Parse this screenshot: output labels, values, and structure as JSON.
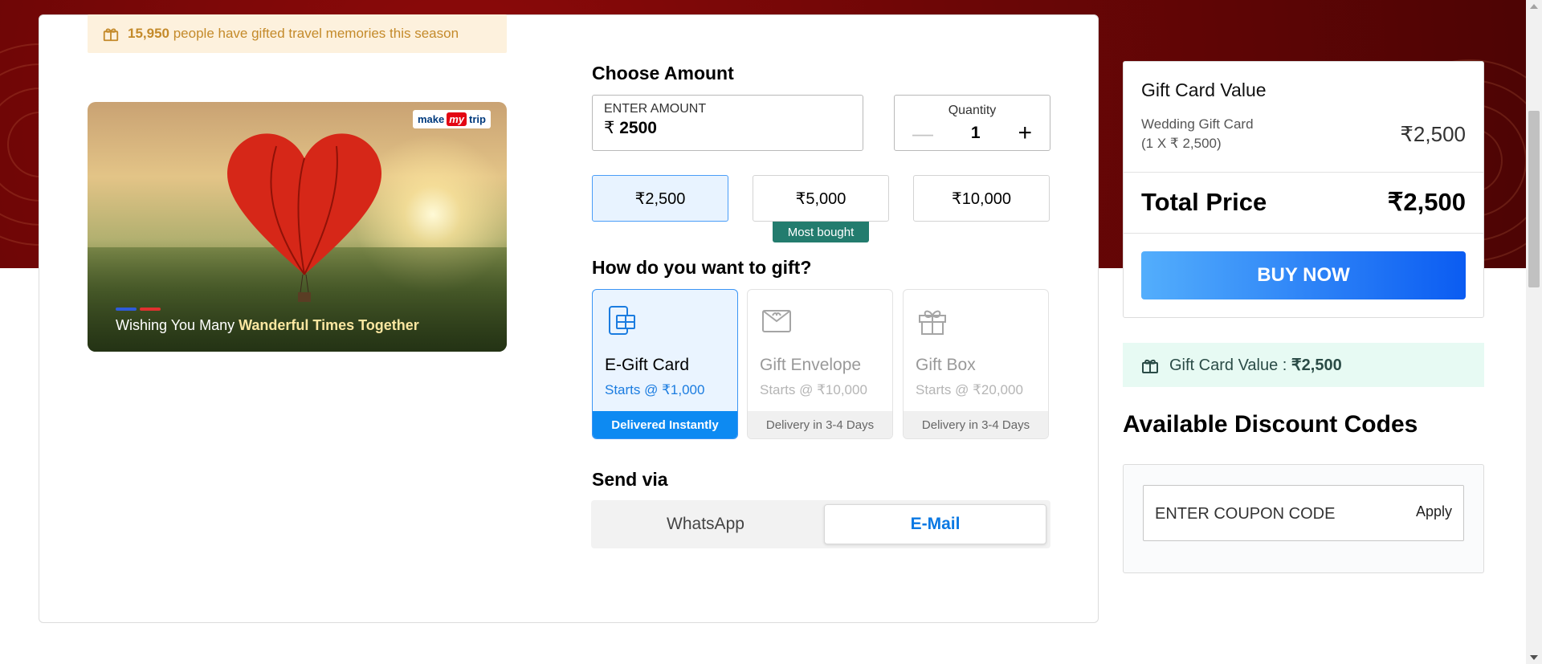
{
  "promo": {
    "count": "15,950",
    "text": " people have gifted travel memories this season",
    "icon": "gift-icon"
  },
  "card": {
    "brand_make": "make",
    "brand_my": "my",
    "brand_trip": "trip",
    "caption_prefix": "Wishing You Many ",
    "caption_bold": "Wanderful Times Together",
    "dot_colors": [
      "#2e5bd8",
      "#e0312f"
    ]
  },
  "choose_amount": {
    "title": "Choose Amount",
    "enter_label": "ENTER AMOUNT",
    "currency": "₹",
    "value": "2500",
    "quantity_label": "Quantity",
    "quantity_minus": "—",
    "quantity_value": "1",
    "quantity_plus": "+",
    "presets": [
      {
        "label": "₹2,500",
        "selected": true
      },
      {
        "label": "₹5,000",
        "selected": false
      },
      {
        "label": "₹10,000",
        "selected": false
      }
    ],
    "most_bought": "Most bought"
  },
  "gift_method": {
    "title": "How do you want to gift?",
    "options": [
      {
        "name": "E-Gift Card",
        "price": "Starts @ ₹1,000",
        "delivery": "Delivered Instantly",
        "icon": "phone-gift-icon",
        "selected": true
      },
      {
        "name": "Gift Envelope",
        "price": "Starts @ ₹10,000",
        "delivery": "Delivery in 3-4 Days",
        "icon": "envelope-icon",
        "selected": false
      },
      {
        "name": "Gift Box",
        "price": "Starts @ ₹20,000",
        "delivery": "Delivery in 3-4 Days",
        "icon": "gift-box-icon",
        "selected": false
      }
    ]
  },
  "send_via": {
    "title": "Send via",
    "options": [
      {
        "label": "WhatsApp",
        "selected": false
      },
      {
        "label": "E-Mail",
        "selected": true
      }
    ]
  },
  "summary": {
    "title": "Gift Card Value",
    "item_name": "Wedding Gift Card",
    "item_detail": "(1 X ₹ 2,500)",
    "item_value": "₹2,500",
    "total_label": "Total Price",
    "total_value": "₹2,500",
    "buy_label": "BUY NOW"
  },
  "gcv_bar": {
    "label": "Gift Card Value : ",
    "value": "₹2,500",
    "icon": "gift-icon"
  },
  "discounts": {
    "title": "Available Discount Codes",
    "placeholder": "ENTER COUPON CODE",
    "apply_label": "Apply"
  },
  "colors": {
    "hero": "#6e0606",
    "accent": "#0d8af2",
    "buy_start": "#53aefc",
    "buy_end": "#0b5cf2",
    "badge": "#237c6e"
  }
}
